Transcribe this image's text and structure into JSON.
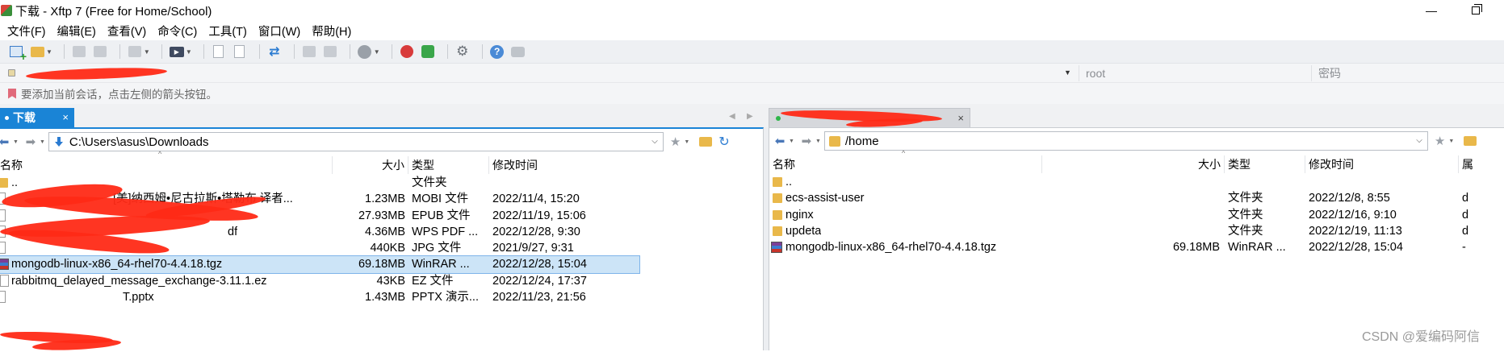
{
  "window": {
    "title": "下载 - Xftp 7 (Free for Home/School)",
    "minimize_glyph": "—",
    "close_hint": ""
  },
  "menu": [
    "文件(F)",
    "编辑(E)",
    "查看(V)",
    "命令(C)",
    "工具(T)",
    "窗口(W)",
    "帮助(H)"
  ],
  "toolbar": {
    "icons": [
      "new-session-icon",
      "open-folder-icon",
      "disconnect-icon",
      "link-icon",
      "new-window-icon",
      "media-icon",
      "document-icon",
      "transfer-icon",
      "sync-icon",
      "copy-icon",
      "paste-icon",
      "stop-icon",
      "xshell-icon",
      "xftp-green-icon",
      "gear-icon",
      "help-icon",
      "chat-icon"
    ]
  },
  "address": {
    "user_placeholder": "root",
    "password_placeholder": "密码"
  },
  "info": {
    "text": "要添加当前会话，点击左侧的箭头按钮。"
  },
  "tabs": {
    "left_label": "下载",
    "close_glyph": "×"
  },
  "left": {
    "path": "C:\\Users\\asus\\Downloads",
    "columns": {
      "name": "名称",
      "size": "大小",
      "type": "类型",
      "modified": "修改时间"
    },
    "rows": [
      {
        "name": "..",
        "size": "",
        "type": "文件夹",
        "modified": "",
        "icon": "folder"
      },
      {
        "name": "",
        "name_tail": "[美]纳西姆•尼古拉斯•塔勒布 译者...",
        "size": "1.23MB",
        "type": "MOBI 文件",
        "modified": "2022/11/4, 15:20",
        "icon": "file",
        "redacted": true
      },
      {
        "name": "",
        "size": "27.93MB",
        "type": "EPUB 文件",
        "modified": "2022/11/19, 15:06",
        "icon": "file",
        "redacted": true
      },
      {
        "name": "",
        "name_tail": "df",
        "size": "4.36MB",
        "type": "WPS PDF ...",
        "modified": "2022/12/28, 9:30",
        "icon": "file",
        "redacted": true
      },
      {
        "name": "",
        "size": "440KB",
        "type": "JPG 文件",
        "modified": "2021/9/27, 9:31",
        "icon": "file",
        "redacted": true
      },
      {
        "name": "mongodb-linux-x86_64-rhel70-4.4.18.tgz",
        "size": "69.18MB",
        "type": "WinRAR ...",
        "modified": "2022/12/28, 15:04",
        "icon": "rar",
        "selected": true
      },
      {
        "name": "rabbitmq_delayed_message_exchange-3.11.1.ez",
        "size": "43KB",
        "type": "EZ 文件",
        "modified": "2022/12/24, 17:37",
        "icon": "file"
      },
      {
        "name": "",
        "name_tail": "T.pptx",
        "size": "1.43MB",
        "type": "PPTX 演示...",
        "modified": "2022/11/23, 21:56",
        "icon": "file",
        "redacted": true
      }
    ]
  },
  "right": {
    "path": "/home",
    "columns": {
      "name": "名称",
      "size": "大小",
      "type": "类型",
      "modified": "修改时间",
      "extra": "属"
    },
    "rows": [
      {
        "name": "..",
        "size": "",
        "type": "",
        "modified": "",
        "extra": "",
        "icon": "folder"
      },
      {
        "name": "ecs-assist-user",
        "size": "",
        "type": "文件夹",
        "modified": "2022/12/8, 8:55",
        "extra": "d",
        "icon": "folder"
      },
      {
        "name": "nginx",
        "size": "",
        "type": "文件夹",
        "modified": "2022/12/16, 9:10",
        "extra": "d",
        "icon": "folder"
      },
      {
        "name": "updeta",
        "size": "",
        "type": "文件夹",
        "modified": "2022/12/19, 11:13",
        "extra": "d",
        "icon": "folder"
      },
      {
        "name": "mongodb-linux-x86_64-rhel70-4.4.18.tgz",
        "size": "69.18MB",
        "type": "WinRAR ...",
        "modified": "2022/12/28, 15:04",
        "extra": "-",
        "icon": "rar"
      }
    ]
  },
  "watermark": "CSDN @爱编码阿信"
}
